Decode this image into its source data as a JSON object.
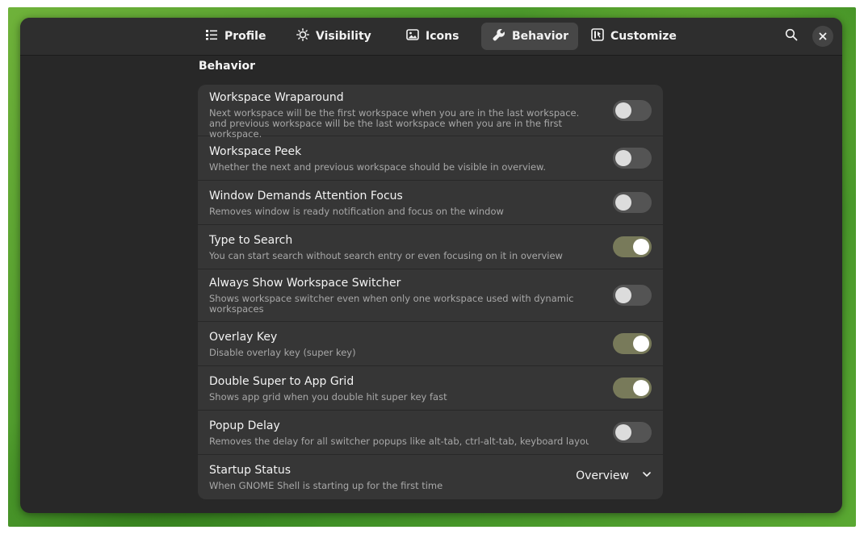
{
  "tabs": [
    {
      "label": "Profile",
      "icon": "list-icon",
      "active": false
    },
    {
      "label": "Visibility",
      "icon": "sun-icon",
      "active": false
    },
    {
      "label": "Icons",
      "icon": "image-icon",
      "active": false
    },
    {
      "label": "Behavior",
      "icon": "wrench-icon",
      "active": true
    },
    {
      "label": "Customize",
      "icon": "customize-icon",
      "active": false
    }
  ],
  "section_title": "Behavior",
  "rows": [
    {
      "title": "Workspace Wraparound",
      "subtitle": "Next workspace will be the first workspace when you are in the last workspace. and previous workspace will be the last workspace when you are in the first workspace.",
      "toggle": false
    },
    {
      "title": "Workspace Peek",
      "subtitle": "Whether the next and previous workspace should be visible in overview.",
      "toggle": false
    },
    {
      "title": "Window Demands Attention Focus",
      "subtitle": "Removes window is ready notification and focus on the window",
      "toggle": false
    },
    {
      "title": "Type to Search",
      "subtitle": "You can start search without search entry or even focusing on it in overview",
      "toggle": true
    },
    {
      "title": "Always Show Workspace Switcher",
      "subtitle": "Shows workspace switcher even when only one workspace used with dynamic workspaces",
      "toggle": false
    },
    {
      "title": "Overlay Key",
      "subtitle": "Disable overlay key (super key)",
      "toggle": true
    },
    {
      "title": "Double Super to App Grid",
      "subtitle": "Shows app grid when you double hit super key fast",
      "toggle": true
    },
    {
      "title": "Popup Delay",
      "subtitle": "Removes the delay for all switcher popups like alt-tab, ctrl-alt-tab, keyboard layout, ...",
      "toggle": false
    }
  ],
  "startup": {
    "title": "Startup Status",
    "subtitle": "When GNOME Shell is starting up for the first time",
    "value": "Overview"
  },
  "colors": {
    "window_bg": "#282828",
    "row_bg": "#363636",
    "toggle_on": "#787a5a",
    "toggle_off": "#545454",
    "wallpaper_green": "#4d9a2c"
  }
}
